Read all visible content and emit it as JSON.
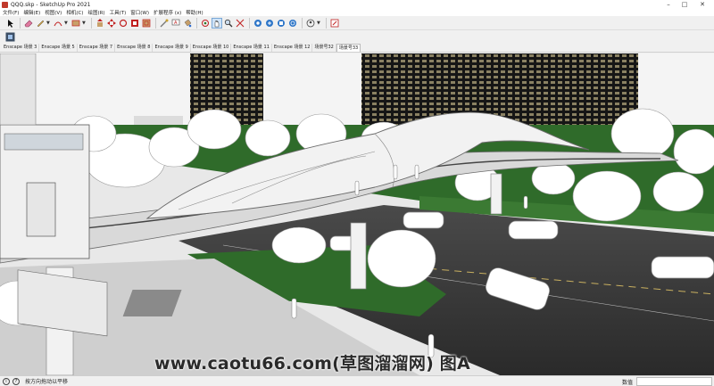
{
  "window": {
    "title": "QQQ.skp - SketchUp Pro 2021"
  },
  "menubar": {
    "items": [
      "文件(F)",
      "编辑(E)",
      "视图(V)",
      "相机(C)",
      "绘图(R)",
      "工具(T)",
      "窗口(W)",
      "扩展程序 (x)",
      "帮助(H)"
    ]
  },
  "toolbar": {
    "icons": [
      "select-icon",
      "eraser-icon",
      "pencil-icon",
      "arc-icon",
      "shape-icon",
      "push-pull-icon",
      "move-icon",
      "rotate-icon",
      "scale-icon",
      "offset-icon",
      "tape-measure-icon",
      "text-icon",
      "paint-bucket-icon",
      "orbit-icon",
      "pan-icon",
      "zoom-icon",
      "zoom-extents-icon",
      "warehouse-icon",
      "extension-warehouse-icon",
      "layout-icon",
      "account-icon",
      "edit-icon"
    ]
  },
  "scene_tabs": {
    "items": [
      "Enscape 场景 3",
      "Enscape 场景 5",
      "Enscape 场景 7",
      "Enscape 场景 8",
      "Enscape 场景 9",
      "Enscape 场景 10",
      "Enscape 场景 11",
      "Enscape 场景 12",
      "场景号32",
      "场景号33"
    ],
    "active_index": 9
  },
  "watermark": {
    "text": "www.caotu66.com(草图溜溜网) 图A"
  },
  "statusbar": {
    "hint": "按方向拖动以平移",
    "measurements_label": "数值"
  },
  "colors": {
    "sky": "#f5f5f5",
    "grass": "#2f6b2a",
    "road": "#3a3a3a",
    "building": "#1a1a1a",
    "window_light": "#e8d9a0"
  }
}
